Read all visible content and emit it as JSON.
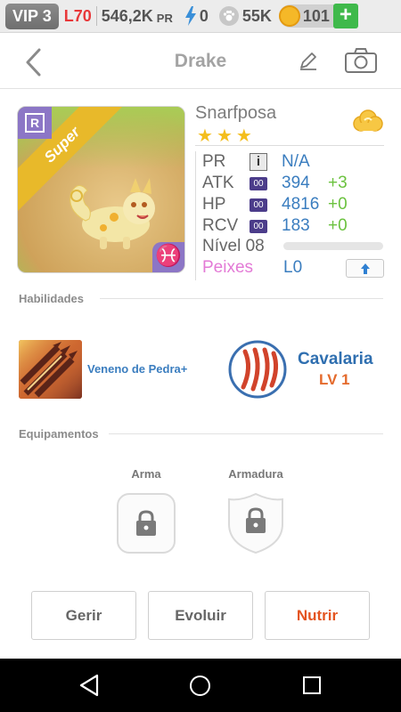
{
  "statusbar": {
    "vip": "VIP 3",
    "level": "L70",
    "pr_value": "546,2K",
    "pr_label": "PR",
    "energy": "0",
    "paw": "55K",
    "coins": "101",
    "plus": "+"
  },
  "header": {
    "title": "Drake"
  },
  "card": {
    "rarity_badge": "R",
    "ribbon": "Super",
    "zodiac": "♓"
  },
  "pet": {
    "name": "Snarfposa",
    "stars": [
      "★",
      "★",
      "★"
    ],
    "stats": [
      {
        "label": "PR",
        "badge": "i",
        "value": "N/A",
        "bonus": ""
      },
      {
        "label": "ATK",
        "badge": "00",
        "value": "394",
        "bonus": "+3"
      },
      {
        "label": "HP",
        "badge": "00",
        "value": "4816",
        "bonus": "+0"
      },
      {
        "label": "RCV",
        "badge": "00",
        "value": "183",
        "bonus": "+0"
      }
    ],
    "nivel": "Nível 08",
    "nivel_progress": 0,
    "peixes_label": "Peixes",
    "peixes_value": "L0"
  },
  "habilidades": {
    "title": "Habilidades",
    "skill_name": "Veneno de Pedra+",
    "cavalaria_name": "Cavalaria",
    "cavalaria_level": "LV 1"
  },
  "equipamentos": {
    "title": "Equipamentos",
    "arma": "Arma",
    "armadura": "Armadura"
  },
  "actions": {
    "gerir": "Gerir",
    "evoluir": "Evoluir",
    "nutrir": "Nutrir"
  },
  "colors": {
    "accent_blue": "#3a7dbf",
    "bonus_green": "#6bc23f",
    "level_red": "#e8383a",
    "nutrir_orange": "#e4541f",
    "peixes_pink": "#e37ad6"
  }
}
